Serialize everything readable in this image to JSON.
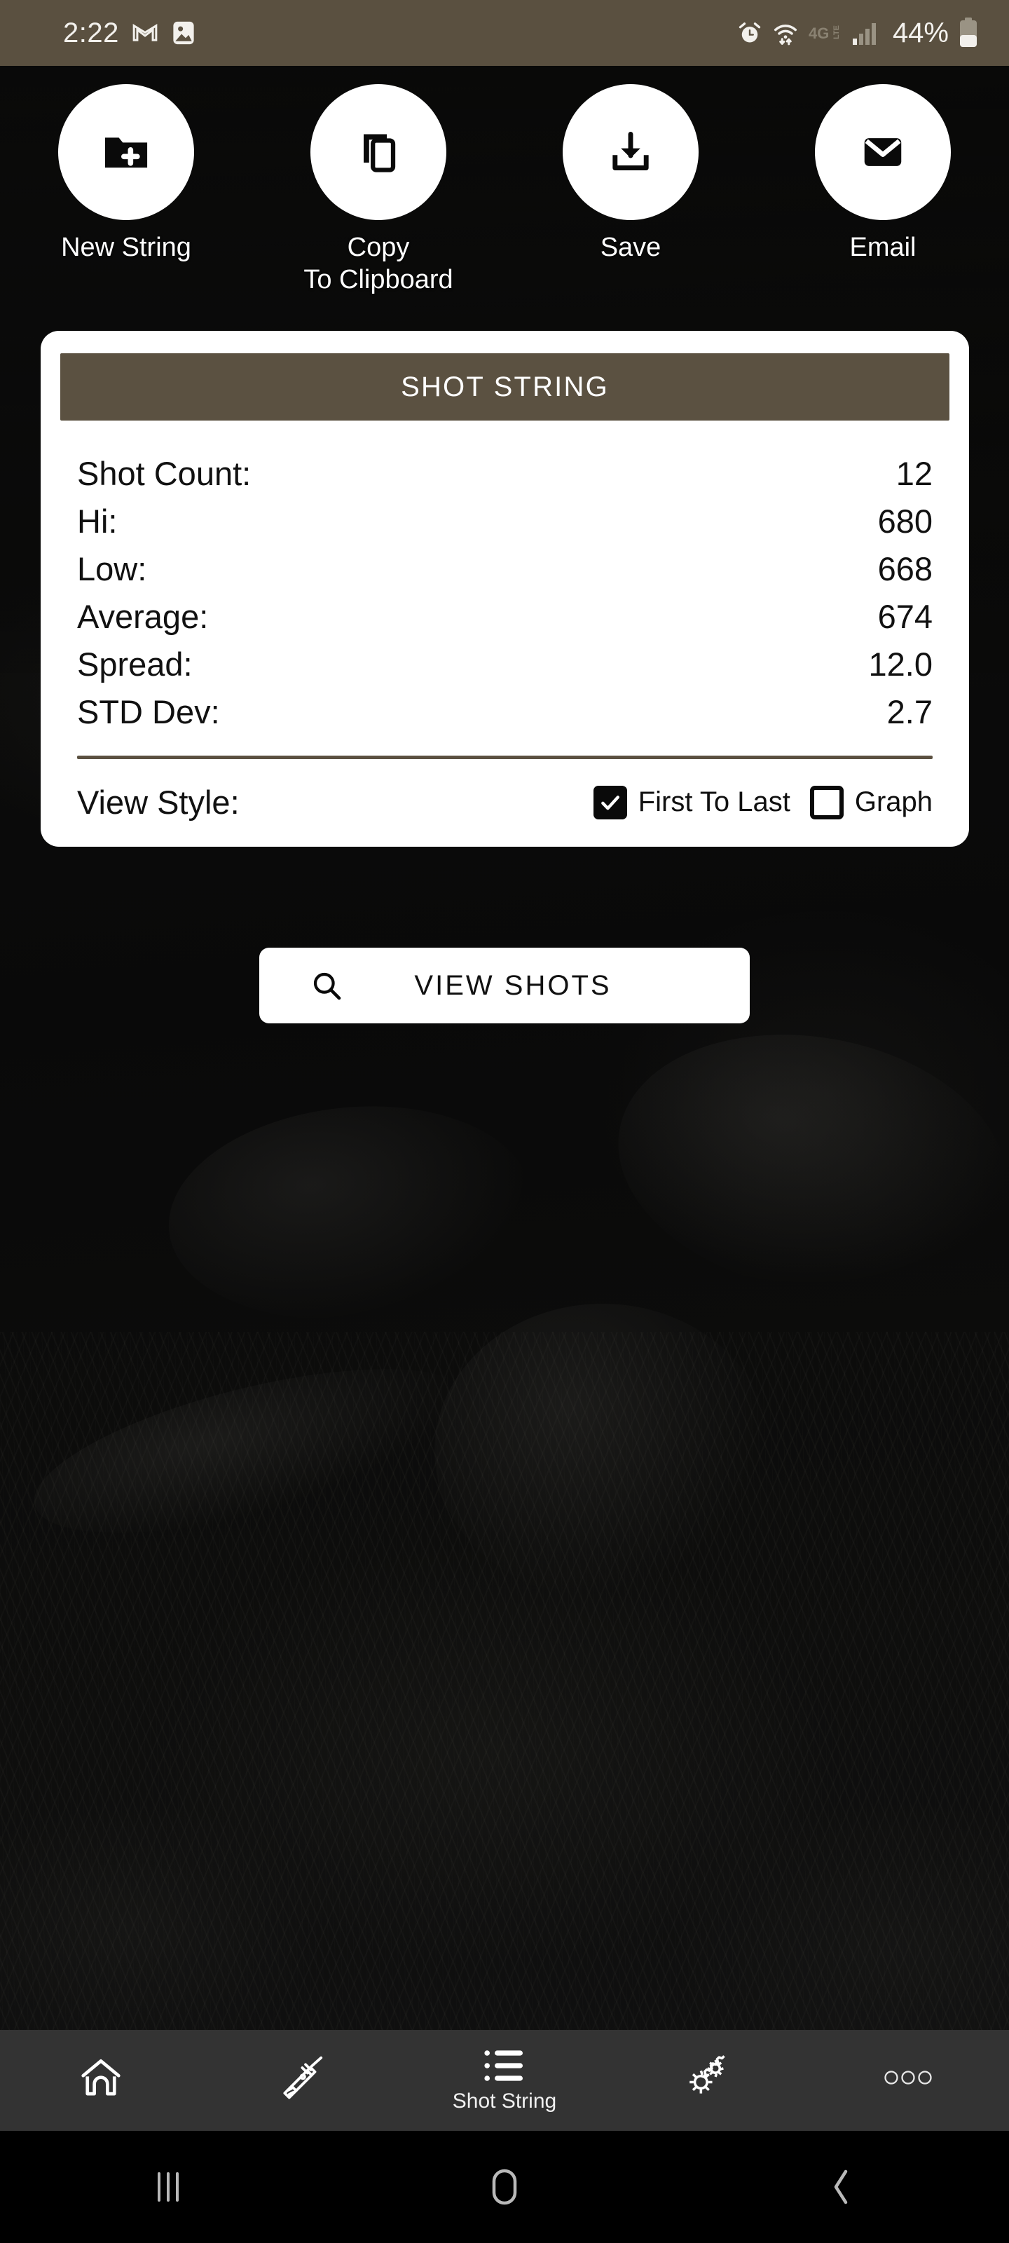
{
  "status_bar": {
    "time": "2:22",
    "left_icons": [
      "gmail-icon",
      "gallery-icon"
    ],
    "right_icons": [
      "alarm-icon",
      "wifi-icon",
      "4g-lte-icon",
      "signal-icon",
      "battery-icon"
    ],
    "network": "4G LTE",
    "battery_percent": "44%",
    "background_color": "#5a5040"
  },
  "actions": [
    {
      "label": "New String",
      "icon": "folder-plus-icon"
    },
    {
      "label": "Copy\nTo Clipboard",
      "label_line1": "Copy",
      "label_line2": "To Clipboard",
      "icon": "copy-icon"
    },
    {
      "label": "Save",
      "icon": "download-icon"
    },
    {
      "label": "Email",
      "icon": "envelope-icon"
    }
  ],
  "card": {
    "title": "SHOT STRING",
    "header_color": "#5b5141",
    "stats": [
      {
        "label": "Shot Count:",
        "value": "12"
      },
      {
        "label": "Hi:",
        "value": "680"
      },
      {
        "label": "Low:",
        "value": "668"
      },
      {
        "label": "Average:",
        "value": "674"
      },
      {
        "label": "Spread:",
        "value": "12.0"
      },
      {
        "label": "STD Dev:",
        "value": "2.7"
      }
    ],
    "view_style": {
      "label": "View Style:",
      "options": [
        {
          "label": "First To Last",
          "checked": true
        },
        {
          "label": "Graph",
          "checked": false
        }
      ]
    }
  },
  "view_shots_button": {
    "label": "VIEW SHOTS",
    "icon": "search-icon"
  },
  "bottom_nav": [
    {
      "label": "",
      "icon": "home-icon",
      "active": false
    },
    {
      "label": "",
      "icon": "rifle-icon",
      "active": false
    },
    {
      "label": "Shot String",
      "icon": "list-icon",
      "active": true
    },
    {
      "label": "",
      "icon": "gears-icon",
      "active": false
    },
    {
      "label": "",
      "icon": "more-icon",
      "active": false
    }
  ],
  "system_nav": [
    {
      "icon": "recents-icon"
    },
    {
      "icon": "home-circle-icon"
    },
    {
      "icon": "back-icon"
    }
  ]
}
